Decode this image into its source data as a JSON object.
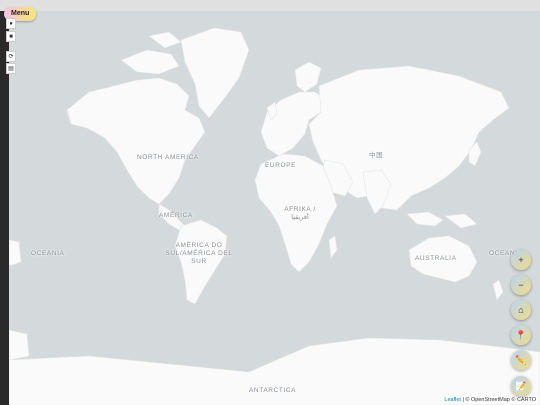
{
  "menu": {
    "label": "Menu"
  },
  "map": {
    "labels": {
      "north_america": "NORTH AMERICA",
      "america": "AMÉRICA",
      "south_america": "AMÉRICA DO SUL/AMÉRICA DEL SUR",
      "europe": "EUROPE",
      "africa": "AFRIKA / أفريقيا",
      "china": "中国",
      "oceania_left": "OCEANIA",
      "oceania_right": "OCEANIA",
      "australia": "AUSTRALIA",
      "antarctica": "ANTARCTICA"
    },
    "land_color": "#fafafa",
    "water_color": "#d4dadc"
  },
  "controls": {
    "zoom_in": "+",
    "zoom_out": "−",
    "home": "⌂",
    "marker": "📍",
    "draw": "✏️",
    "note": "📝",
    "tool_a": "●",
    "tool_b": "■",
    "tool_c": "⟳",
    "tool_d": "▤"
  },
  "attribution": {
    "leaflet": "Leaflet",
    "rest": "| © OpenStreetMap © CARTO"
  }
}
